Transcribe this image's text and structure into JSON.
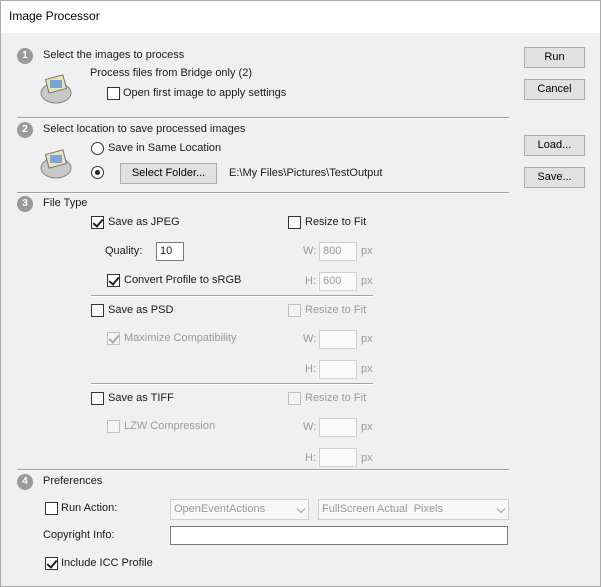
{
  "window": {
    "title": "Image Processor"
  },
  "sections": {
    "s1": {
      "num": "1",
      "heading": "Select the images to process",
      "source": "Process files from Bridge only (2)",
      "open_first": "Open first image to apply settings"
    },
    "s2": {
      "num": "2",
      "heading": "Select location to save processed images",
      "same_location": "Save in Same Location",
      "select_folder": "Select Folder...",
      "folder_path": "E:\\My Files\\Pictures\\TestOutput"
    },
    "s3": {
      "num": "3",
      "heading": "File Type",
      "jpeg": {
        "save_label": "Save as JPEG",
        "resize_label": "Resize to Fit",
        "quality_label": "Quality:",
        "quality_value": "10",
        "w_label": "W:",
        "w_value": "800",
        "h_label": "H:",
        "h_value": "600",
        "unit": "px",
        "convert_label": "Convert Profile to sRGB"
      },
      "psd": {
        "save_label": "Save as PSD",
        "resize_label": "Resize to Fit",
        "maximize_label": "Maximize Compatibility",
        "w_label": "W:",
        "h_label": "H:",
        "unit": "px"
      },
      "tiff": {
        "save_label": "Save as TIFF",
        "resize_label": "Resize to Fit",
        "lzw_label": "LZW Compression",
        "w_label": "W:",
        "h_label": "H:",
        "unit": "px"
      }
    },
    "s4": {
      "num": "4",
      "heading": "Preferences",
      "run_action": "Run Action:",
      "action_set": "OpenEventActions",
      "action": "FullScreen Actual  Pixels",
      "copyright_label": "Copyright Info:",
      "copyright_value": "",
      "icc_label": "Include ICC Profile"
    }
  },
  "buttons": {
    "run": "Run",
    "cancel": "Cancel",
    "load": "Load...",
    "save": "Save..."
  }
}
